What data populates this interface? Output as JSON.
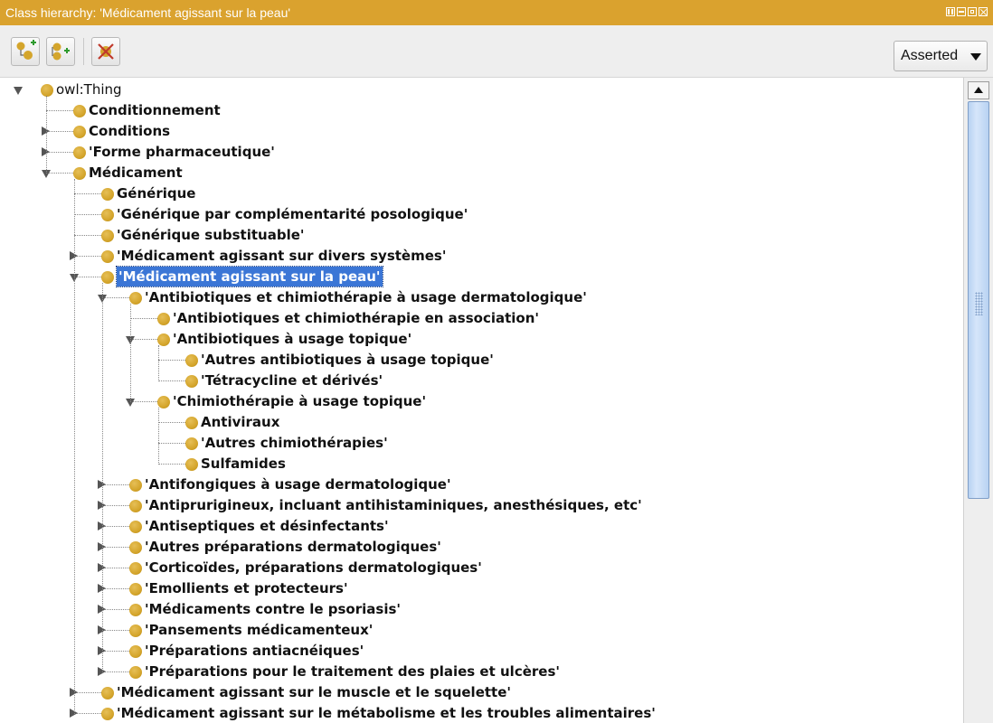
{
  "window": {
    "title": "Class hierarchy: 'Médicament agissant sur la peau'"
  },
  "toolbar": {
    "buttons": [
      {
        "name": "add-subclass",
        "icon": "add-subclass-icon"
      },
      {
        "name": "add-sibling",
        "icon": "add-sibling-icon"
      },
      {
        "name": "delete-class",
        "icon": "delete-class-icon"
      }
    ],
    "view_mode": "Asserted"
  },
  "tree": {
    "nodes": [
      {
        "label": "owl:Thing",
        "depth": 0,
        "expander": "open",
        "bold": false,
        "selected": false
      },
      {
        "label": "Conditionnement",
        "depth": 1,
        "expander": "none",
        "bold": true,
        "selected": false
      },
      {
        "label": "Conditions",
        "depth": 1,
        "expander": "closed",
        "bold": true,
        "selected": false
      },
      {
        "label": "'Forme pharmaceutique'",
        "depth": 1,
        "expander": "closed",
        "bold": true,
        "selected": false
      },
      {
        "label": "Médicament",
        "depth": 1,
        "expander": "open",
        "bold": true,
        "selected": false
      },
      {
        "label": "Générique",
        "depth": 2,
        "expander": "none",
        "bold": true,
        "selected": false
      },
      {
        "label": "'Générique par complémentarité posologique'",
        "depth": 2,
        "expander": "none",
        "bold": true,
        "selected": false
      },
      {
        "label": "'Générique substituable'",
        "depth": 2,
        "expander": "none",
        "bold": true,
        "selected": false
      },
      {
        "label": "'Médicament agissant sur divers systèmes'",
        "depth": 2,
        "expander": "closed",
        "bold": true,
        "selected": false
      },
      {
        "label": "'Médicament agissant sur la peau'",
        "depth": 2,
        "expander": "open",
        "bold": true,
        "selected": true
      },
      {
        "label": "'Antibiotiques et chimiothérapie à usage dermatologique'",
        "depth": 3,
        "expander": "open",
        "bold": true,
        "selected": false
      },
      {
        "label": "'Antibiotiques et chimiothérapie en association'",
        "depth": 4,
        "expander": "none",
        "bold": true,
        "selected": false
      },
      {
        "label": "'Antibiotiques à usage topique'",
        "depth": 4,
        "expander": "open",
        "bold": true,
        "selected": false
      },
      {
        "label": "'Autres antibiotiques à usage topique'",
        "depth": 5,
        "expander": "none",
        "bold": true,
        "selected": false
      },
      {
        "label": "'Tétracycline et dérivés'",
        "depth": 5,
        "expander": "none",
        "bold": true,
        "selected": false
      },
      {
        "label": "'Chimiothérapie à usage topique'",
        "depth": 4,
        "expander": "open",
        "bold": true,
        "selected": false
      },
      {
        "label": "Antiviraux",
        "depth": 5,
        "expander": "none",
        "bold": true,
        "selected": false
      },
      {
        "label": "'Autres chimiothérapies'",
        "depth": 5,
        "expander": "none",
        "bold": true,
        "selected": false
      },
      {
        "label": "Sulfamides",
        "depth": 5,
        "expander": "none",
        "bold": true,
        "selected": false
      },
      {
        "label": "'Antifongiques à usage dermatologique'",
        "depth": 3,
        "expander": "closed",
        "bold": true,
        "selected": false
      },
      {
        "label": "'Antiprurigineux, incluant antihistaminiques, anesthésiques, etc'",
        "depth": 3,
        "expander": "closed",
        "bold": true,
        "selected": false
      },
      {
        "label": "'Antiseptiques et désinfectants'",
        "depth": 3,
        "expander": "closed",
        "bold": true,
        "selected": false
      },
      {
        "label": "'Autres préparations dermatologiques'",
        "depth": 3,
        "expander": "closed",
        "bold": true,
        "selected": false
      },
      {
        "label": "'Corticoïdes, préparations dermatologiques'",
        "depth": 3,
        "expander": "closed",
        "bold": true,
        "selected": false
      },
      {
        "label": "'Emollients et protecteurs'",
        "depth": 3,
        "expander": "closed",
        "bold": true,
        "selected": false
      },
      {
        "label": "'Médicaments contre le psoriasis'",
        "depth": 3,
        "expander": "closed",
        "bold": true,
        "selected": false
      },
      {
        "label": "'Pansements médicamenteux'",
        "depth": 3,
        "expander": "closed",
        "bold": true,
        "selected": false
      },
      {
        "label": "'Préparations antiacnéiques'",
        "depth": 3,
        "expander": "closed",
        "bold": true,
        "selected": false
      },
      {
        "label": "'Préparations pour le traitement des plaies et ulcères'",
        "depth": 3,
        "expander": "closed",
        "bold": true,
        "selected": false
      },
      {
        "label": "'Médicament agissant sur le muscle et le squelette'",
        "depth": 2,
        "expander": "closed",
        "bold": true,
        "selected": false
      },
      {
        "label": "'Médicament agissant sur le métabolisme et les troubles alimentaires'",
        "depth": 2,
        "expander": "closed",
        "bold": true,
        "selected": false
      }
    ]
  },
  "colors": {
    "title_bar": "#daa22e",
    "class_dot": "#d4a52c",
    "selection": "#3b76d6"
  }
}
